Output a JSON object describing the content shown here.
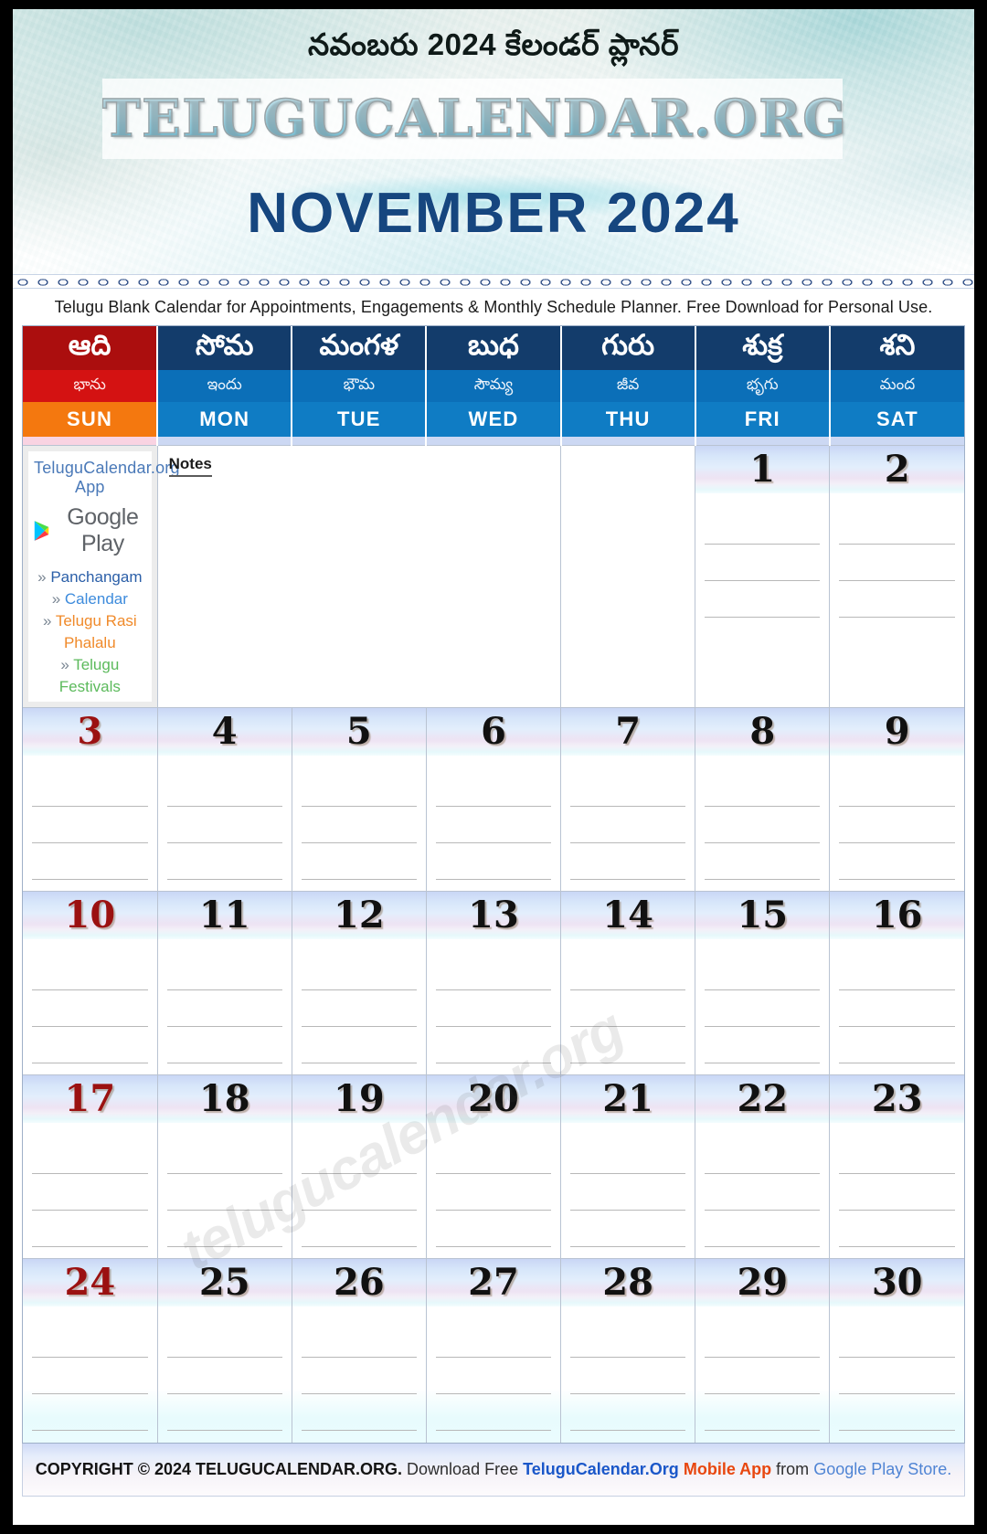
{
  "masthead": {
    "telugu_title": "నవంబరు 2024 కేలండర్ ప్లానర్",
    "brand": "TELUGUCALENDAR.ORG",
    "month_title": "NOVEMBER 2024"
  },
  "tagline": "Telugu Blank Calendar for Appointments, Engagements & Monthly Schedule Planner. Free Download for Personal Use.",
  "weekday_headers": [
    {
      "telugu": "ఆది",
      "telugu_alt": "భాను",
      "short": "SUN",
      "is_sunday": true
    },
    {
      "telugu": "సోమ",
      "telugu_alt": "ఇందు",
      "short": "MON",
      "is_sunday": false
    },
    {
      "telugu": "మంగళ",
      "telugu_alt": "భౌమ",
      "short": "TUE",
      "is_sunday": false
    },
    {
      "telugu": "బుధ",
      "telugu_alt": "సౌమ్య",
      "short": "WED",
      "is_sunday": false
    },
    {
      "telugu": "గురు",
      "telugu_alt": "జీవ",
      "short": "THU",
      "is_sunday": false
    },
    {
      "telugu": "శుక్ర",
      "telugu_alt": "భృగు",
      "short": "FRI",
      "is_sunday": false
    },
    {
      "telugu": "శని",
      "telugu_alt": "మంద",
      "short": "SAT",
      "is_sunday": false
    }
  ],
  "promo": {
    "title": "TeluguCalendar.org App",
    "store_name": "Google Play",
    "store_icon": "google-play-icon",
    "chevron": "»",
    "links": [
      {
        "label": "Panchangam",
        "color_class": "lnk-blue-dark"
      },
      {
        "label": "Calendar",
        "color_class": "lnk-blue"
      },
      {
        "label": "Telugu Rasi Phalalu",
        "color_class": "lnk-orange"
      },
      {
        "label": "Telugu Festivals",
        "color_class": "lnk-green"
      }
    ]
  },
  "notes": {
    "label": "Notes"
  },
  "watermark": "telugucalendar.org",
  "weeks": [
    [
      {
        "type": "promo"
      },
      {
        "type": "notes"
      },
      {
        "type": "notes-span"
      },
      {
        "type": "notes-span"
      },
      {
        "type": "empty"
      },
      {
        "type": "day",
        "num": "1",
        "sunday": false
      },
      {
        "type": "day",
        "num": "2",
        "sunday": false
      }
    ],
    [
      {
        "type": "day",
        "num": "3",
        "sunday": true
      },
      {
        "type": "day",
        "num": "4",
        "sunday": false
      },
      {
        "type": "day",
        "num": "5",
        "sunday": false
      },
      {
        "type": "day",
        "num": "6",
        "sunday": false
      },
      {
        "type": "day",
        "num": "7",
        "sunday": false
      },
      {
        "type": "day",
        "num": "8",
        "sunday": false
      },
      {
        "type": "day",
        "num": "9",
        "sunday": false
      }
    ],
    [
      {
        "type": "day",
        "num": "10",
        "sunday": true
      },
      {
        "type": "day",
        "num": "11",
        "sunday": false
      },
      {
        "type": "day",
        "num": "12",
        "sunday": false
      },
      {
        "type": "day",
        "num": "13",
        "sunday": false
      },
      {
        "type": "day",
        "num": "14",
        "sunday": false
      },
      {
        "type": "day",
        "num": "15",
        "sunday": false
      },
      {
        "type": "day",
        "num": "16",
        "sunday": false
      }
    ],
    [
      {
        "type": "day",
        "num": "17",
        "sunday": true
      },
      {
        "type": "day",
        "num": "18",
        "sunday": false
      },
      {
        "type": "day",
        "num": "19",
        "sunday": false
      },
      {
        "type": "day",
        "num": "20",
        "sunday": false
      },
      {
        "type": "day",
        "num": "21",
        "sunday": false
      },
      {
        "type": "day",
        "num": "22",
        "sunday": false
      },
      {
        "type": "day",
        "num": "23",
        "sunday": false
      }
    ],
    [
      {
        "type": "day",
        "num": "24",
        "sunday": true
      },
      {
        "type": "day",
        "num": "25",
        "sunday": false
      },
      {
        "type": "day",
        "num": "26",
        "sunday": false
      },
      {
        "type": "day",
        "num": "27",
        "sunday": false
      },
      {
        "type": "day",
        "num": "28",
        "sunday": false
      },
      {
        "type": "day",
        "num": "29",
        "sunday": false
      },
      {
        "type": "day",
        "num": "30",
        "sunday": false
      }
    ]
  ],
  "footer": {
    "copyright": "COPYRIGHT © 2024 TELUGUCALENDAR.ORG.",
    "download": "Download Free",
    "brand": "TeluguCalendar.Org",
    "app": "Mobile App",
    "from": "from",
    "store": "Google Play Store."
  },
  "colors": {
    "sunday_header": "#ab0e0e",
    "weekday_header": "#133c6b",
    "sunday_accent": "#f4780f",
    "weekday_accent": "#0f7cc4",
    "month_title": "#16467f",
    "sunday_number": "#9b1111"
  }
}
